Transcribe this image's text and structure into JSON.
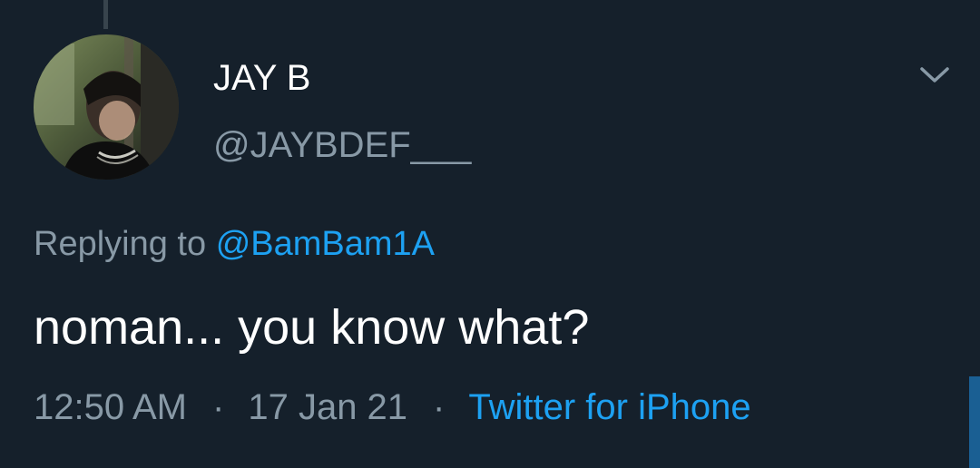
{
  "user": {
    "display_name": "JAY B",
    "handle": "@JAYBDEF___"
  },
  "reply": {
    "prefix": "Replying to",
    "mention": "@BamBam1A"
  },
  "tweet": {
    "text": "noman... you know what?"
  },
  "meta": {
    "time": "12:50 AM",
    "separator": "·",
    "date": "17 Jan 21",
    "source": "Twitter for iPhone"
  },
  "icons": {
    "menu": "chevron-down-icon",
    "avatar": "avatar-photo"
  },
  "colors": {
    "background": "#15202b",
    "primary_text": "#ffffff",
    "secondary_text": "#8899a6",
    "accent": "#1da1f2"
  }
}
